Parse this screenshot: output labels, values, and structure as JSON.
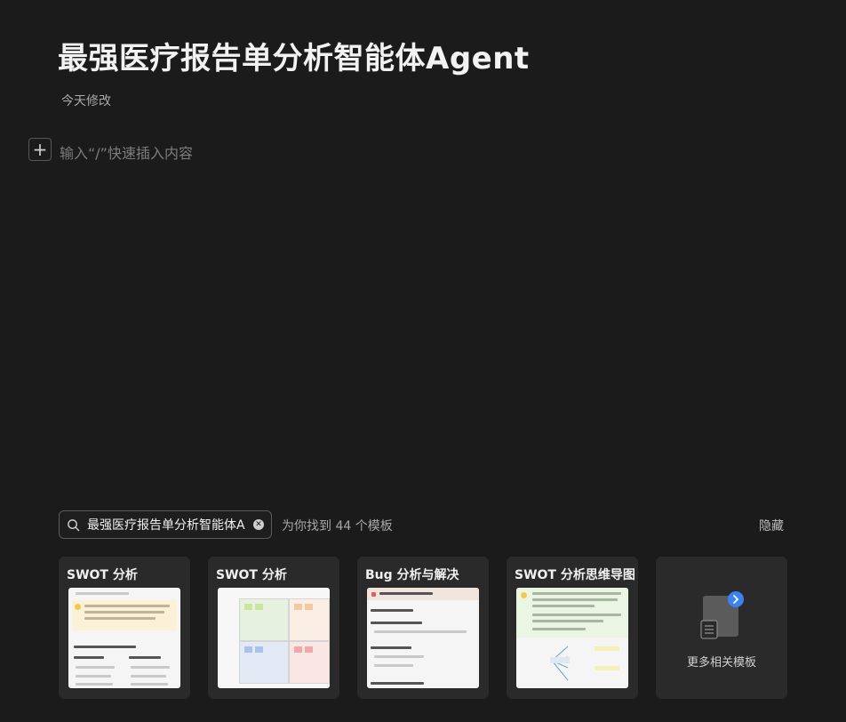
{
  "doc": {
    "title": "最强医疗报告单分析智能体Agent",
    "modified": "今天修改",
    "insert_placeholder": "输入“/”快速插入内容"
  },
  "templates": {
    "search_value": "最强医疗报告单分析智能体A",
    "found_text": "为你找到 44 个模板",
    "hide_label": "隐藏",
    "cards": [
      {
        "title": "SWOT 分析"
      },
      {
        "title": "SWOT 分析"
      },
      {
        "title": "Bug 分析与解决"
      },
      {
        "title": "SWOT 分析思维导图"
      }
    ],
    "more_label": "更多相关模板"
  },
  "colors": {
    "background": "#1b1b1c",
    "card": "#2a2a2b",
    "accent": "#3b82f6"
  }
}
